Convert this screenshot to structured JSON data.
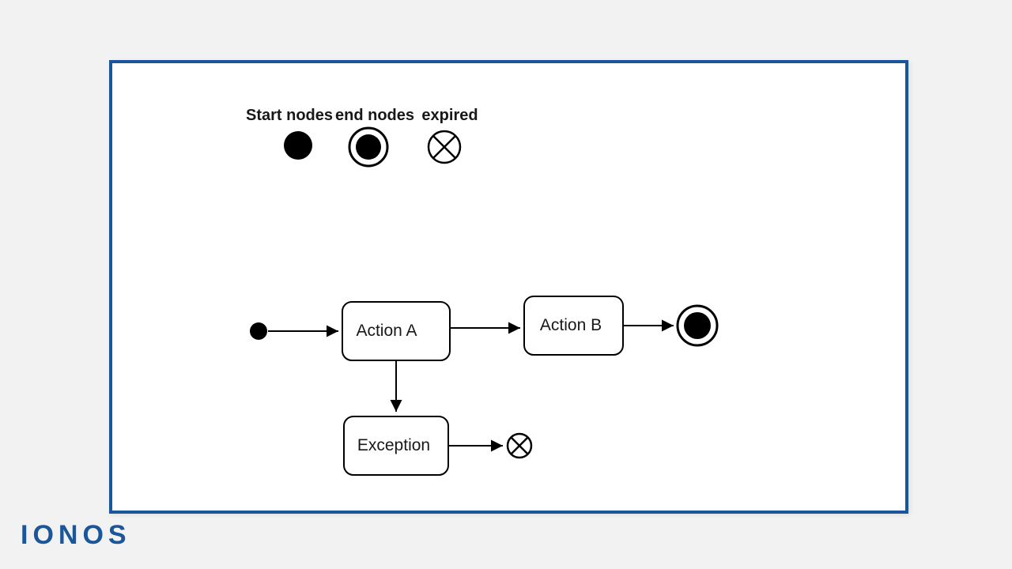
{
  "brand": "IONOS",
  "legend": {
    "start": "Start nodes",
    "end": "end nodes",
    "expired": "expired"
  },
  "flow": {
    "nodes": {
      "actionA": "Action A",
      "actionB": "Action B",
      "exception": "Exception"
    }
  },
  "colors": {
    "border": "#1a5699",
    "ink": "#000000"
  }
}
